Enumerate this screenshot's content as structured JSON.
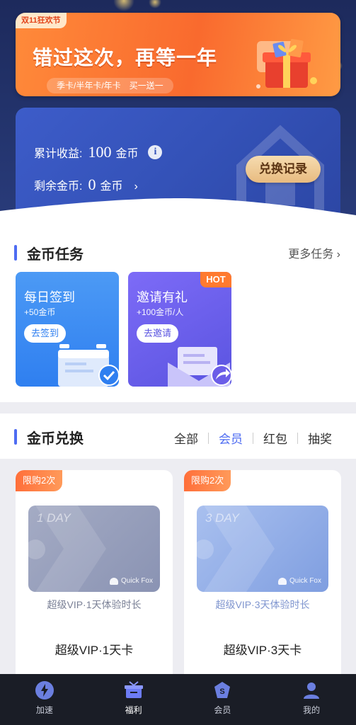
{
  "banner": {
    "tag": "双11狂欢节",
    "title": "错过这次，再等一年",
    "subtitle": "季卡/半年卡/年卡　买一送一"
  },
  "earnings": {
    "total_label": "累计收益:",
    "total_value": "100",
    "total_unit": "金币",
    "remaining_label": "剩余金币:",
    "remaining_value": "0",
    "remaining_unit": "金币",
    "exchange_record_button": "兑换记录"
  },
  "coin_tasks": {
    "title": "金币任务",
    "more": "更多任务",
    "tasks": [
      {
        "title": "每日签到",
        "reward": "+50金币",
        "button": "去签到"
      },
      {
        "title": "邀请有礼",
        "reward": "+100金币/人",
        "button": "去邀请",
        "badge": "HOT"
      }
    ]
  },
  "coin_exchange": {
    "title": "金币兑换",
    "tabs": [
      "全部",
      "会员",
      "红包",
      "抽奖"
    ],
    "active_tab": "会员",
    "items": [
      {
        "limit": "限购2次",
        "card_label": "1 DAY",
        "brand": "Quick Fox",
        "desc": "超级VIP·1天体验时长",
        "name": "超级VIP·1天卡"
      },
      {
        "limit": "限购2次",
        "card_label": "3 DAY",
        "brand": "Quick Fox",
        "desc": "超级VIP·3天体验时长",
        "name": "超级VIP·3天卡"
      }
    ]
  },
  "nav": {
    "items": [
      {
        "label": "加速",
        "icon": "lightning-icon"
      },
      {
        "label": "福利",
        "icon": "gift-icon"
      },
      {
        "label": "会员",
        "icon": "vip-icon"
      },
      {
        "label": "我的",
        "icon": "user-icon"
      }
    ],
    "active": "福利"
  },
  "colors": {
    "accent": "#4e6cf2",
    "banner_orange": "#f96a2e",
    "card_blue": "#3452b8",
    "gold": "#e8bb80",
    "nav_bg": "#1a1d26"
  }
}
